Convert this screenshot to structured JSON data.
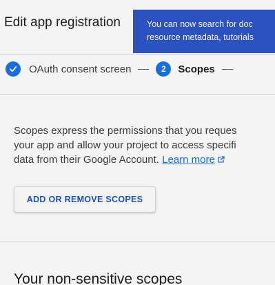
{
  "header": {
    "title": "Edit app registration"
  },
  "toast": {
    "line1": "You can now search for doc",
    "line2": "resource metadata, tutorials"
  },
  "stepper": {
    "steps": [
      {
        "label": "OAuth consent screen",
        "state": "completed",
        "icon": "check-icon"
      },
      {
        "number": "2",
        "label": "Scopes",
        "state": "active"
      }
    ]
  },
  "description": {
    "line1": "Scopes express the permissions that you reques",
    "line2": "your app and allow your project to access specifi",
    "line3_prefix": "data from their Google Account. ",
    "learn_more": "Learn more",
    "learn_more_icon": "external-link-icon"
  },
  "actions": {
    "add_remove_scopes": "ADD OR REMOVE SCOPES"
  },
  "sections": {
    "non_sensitive_title": "Your non-sensitive scopes"
  },
  "colors": {
    "accent": "#1a73e8",
    "toast_bg": "#2f56c8",
    "button_text": "#1a53c8"
  }
}
